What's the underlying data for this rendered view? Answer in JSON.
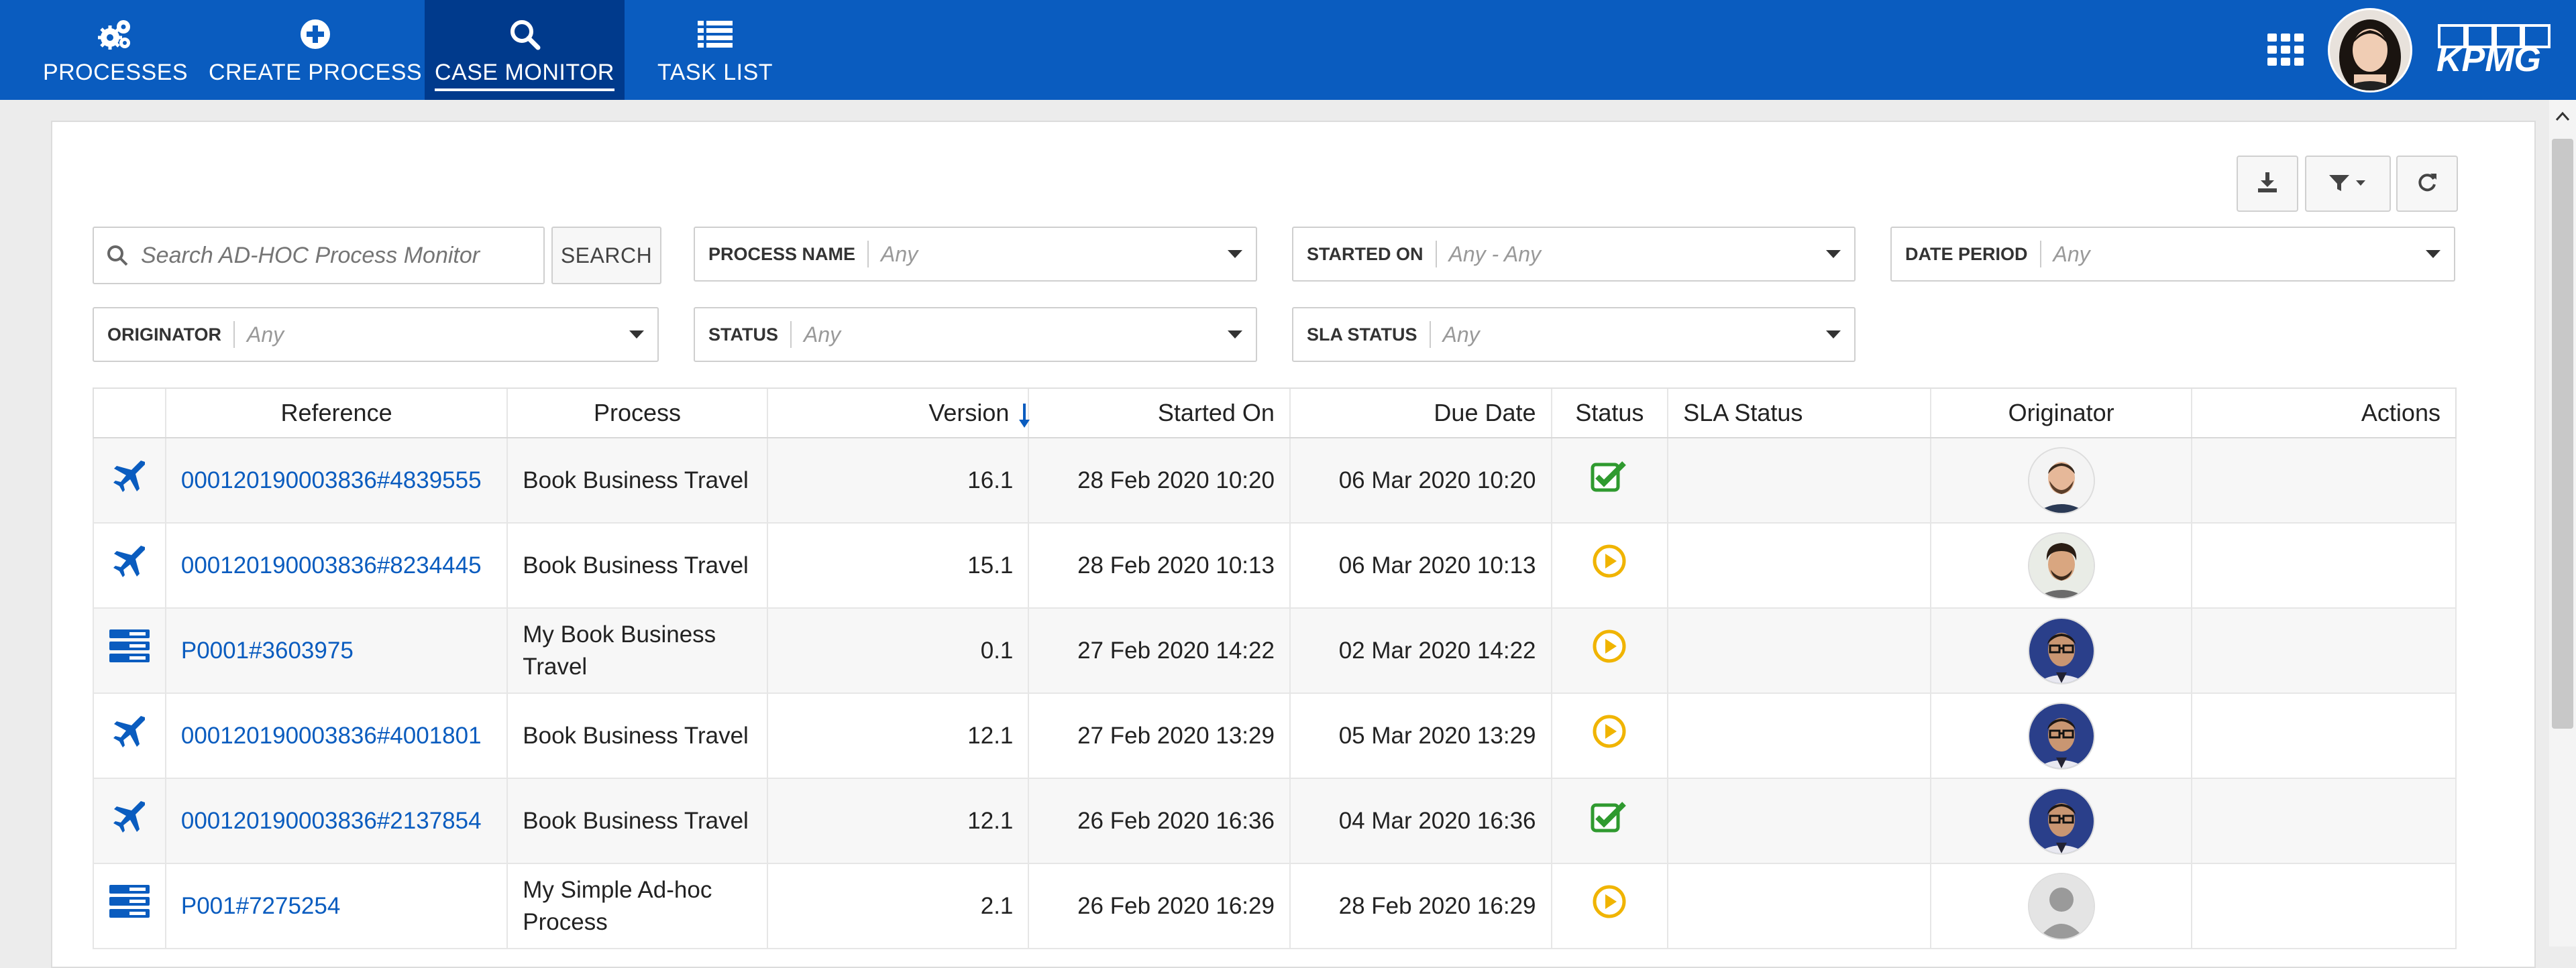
{
  "nav": {
    "items": [
      {
        "label": "PROCESSES",
        "icon": "gears-icon"
      },
      {
        "label": "CREATE PROCESS",
        "icon": "plus-circle-icon"
      },
      {
        "label": "CASE MONITOR",
        "icon": "search-icon",
        "active": true
      },
      {
        "label": "TASK LIST",
        "icon": "list-icon"
      }
    ],
    "brand": "KPMG",
    "apps_icon": "grid-apps-icon"
  },
  "toolbar": {
    "download_icon": "download-icon",
    "filter_icon": "filter-dropdown-icon",
    "refresh_icon": "refresh-icon"
  },
  "search": {
    "placeholder": "Search AD-HOC Process Monitor",
    "button_label": "SEARCH"
  },
  "filters": [
    {
      "label": "PROCESS NAME",
      "value": "Any"
    },
    {
      "label": "STARTED ON",
      "value": "Any - Any"
    },
    {
      "label": "DATE PERIOD",
      "value": "Any"
    },
    {
      "label": "ORIGINATOR",
      "value": "Any"
    },
    {
      "label": "STATUS",
      "value": "Any"
    },
    {
      "label": "SLA STATUS",
      "value": "Any"
    }
  ],
  "table": {
    "columns": [
      "",
      "Reference",
      "Process",
      "Version",
      "Started On",
      "Due Date",
      "Status",
      "SLA Status",
      "Originator",
      "Actions"
    ],
    "sort_column": "Started On",
    "sort_direction": "descending",
    "rows": [
      {
        "type_icon": "airplane-icon",
        "reference": "000120190003836#4839555",
        "process": "Book Business Travel",
        "version": "16.1",
        "started_on": "28 Feb 2020 10:20",
        "due_date": "06 Mar 2020 10:20",
        "status_icon": "check-square-icon",
        "sla_status": "",
        "originator": "man-beard"
      },
      {
        "type_icon": "airplane-icon",
        "reference": "000120190003836#8234445",
        "process": "Book Business Travel",
        "version": "15.1",
        "started_on": "28 Feb 2020 10:13",
        "due_date": "06 Mar 2020 10:13",
        "status_icon": "play-circle-icon",
        "sla_status": "",
        "originator": "man-curly"
      },
      {
        "type_icon": "server-icon",
        "reference": "P0001#3603975",
        "process": "My Book Business Travel",
        "version": "0.1",
        "started_on": "27 Feb 2020 14:22",
        "due_date": "02 Mar 2020 14:22",
        "status_icon": "play-circle-icon",
        "sla_status": "",
        "originator": "man-glasses"
      },
      {
        "type_icon": "airplane-icon",
        "reference": "000120190003836#4001801",
        "process": "Book Business Travel",
        "version": "12.1",
        "started_on": "27 Feb 2020 13:29",
        "due_date": "05 Mar 2020 13:29",
        "status_icon": "play-circle-icon",
        "sla_status": "",
        "originator": "man-glasses"
      },
      {
        "type_icon": "airplane-icon",
        "reference": "000120190003836#2137854",
        "process": "Book Business Travel",
        "version": "12.1",
        "started_on": "26 Feb 2020 16:36",
        "due_date": "04 Mar 2020 16:36",
        "status_icon": "check-square-icon",
        "sla_status": "",
        "originator": "man-glasses"
      },
      {
        "type_icon": "server-icon",
        "reference": "P001#7275254",
        "process": "My Simple Ad-hoc Process",
        "version": "2.1",
        "started_on": "26 Feb 2020 16:29",
        "due_date": "28 Feb 2020 16:29",
        "status_icon": "play-circle-icon",
        "sla_status": "",
        "originator": "default-user"
      }
    ]
  },
  "colors": {
    "nav_bg": "#0a5cbf",
    "nav_active": "#003a8c",
    "link": "#0a5cbf",
    "status_check": "#2f9a2f",
    "status_play": "#f0b400"
  }
}
